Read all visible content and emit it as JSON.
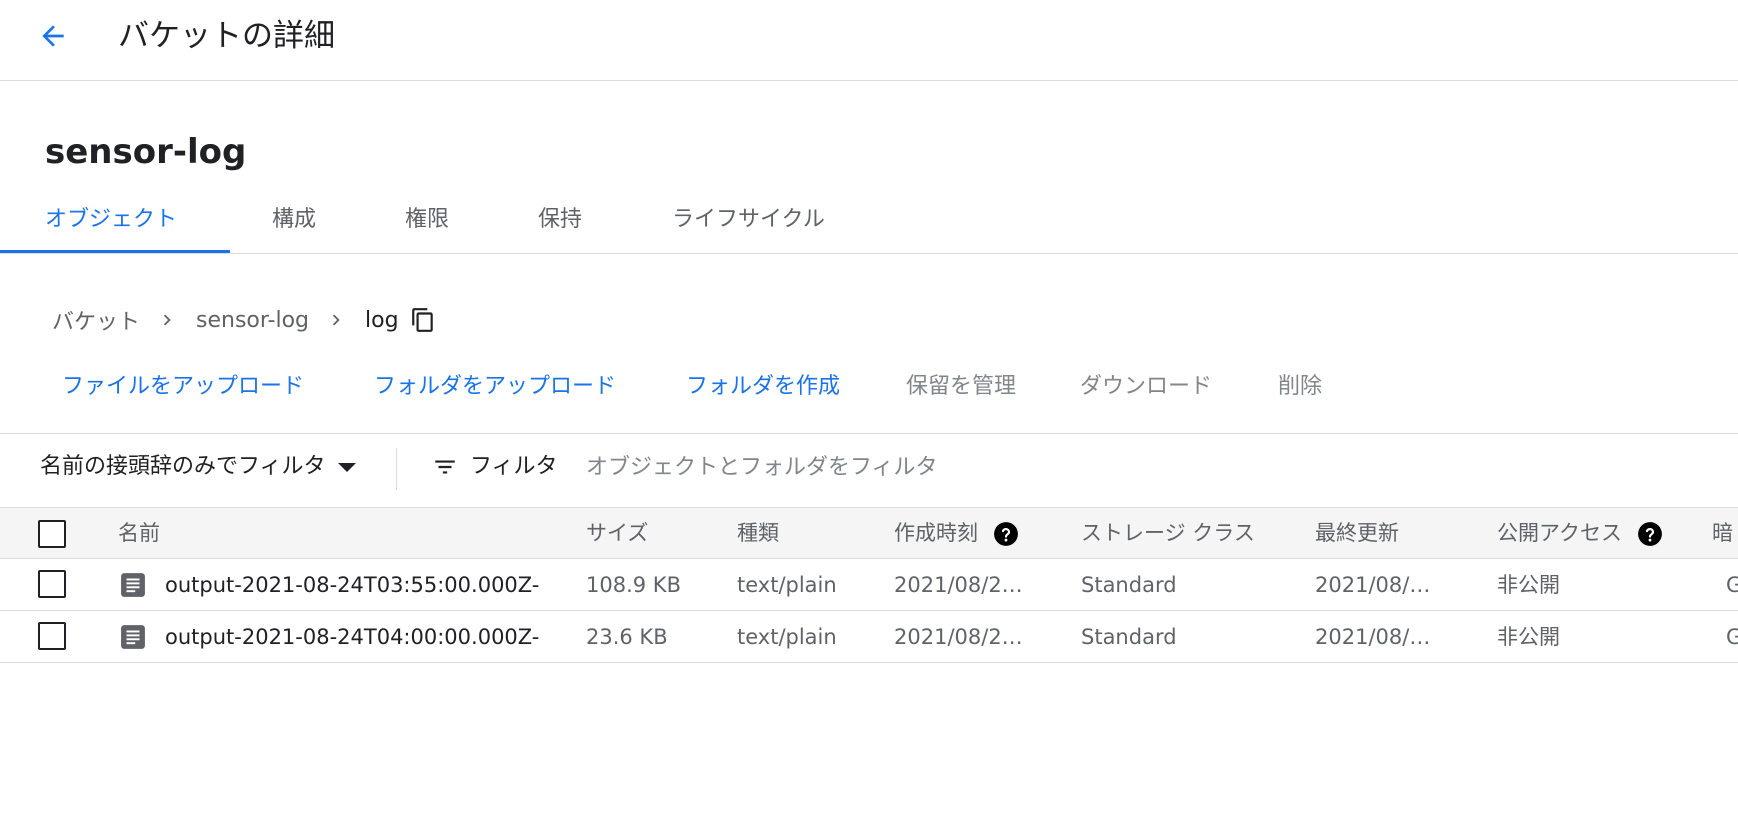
{
  "header": {
    "back_icon": "arrow-left-icon",
    "title": "バケットの詳細"
  },
  "bucket": {
    "name": "sensor-log"
  },
  "tabs": [
    {
      "label": "オブジェクト",
      "active": true
    },
    {
      "label": "構成",
      "active": false
    },
    {
      "label": "権限",
      "active": false
    },
    {
      "label": "保持",
      "active": false
    },
    {
      "label": "ライフサイクル",
      "active": false
    }
  ],
  "breadcrumb": {
    "items": [
      "バケット",
      "sensor-log",
      "log"
    ],
    "copy_icon": "copy-icon"
  },
  "actions": [
    {
      "label": "ファイルをアップロード",
      "enabled": true
    },
    {
      "label": "フォルダをアップロード",
      "enabled": true
    },
    {
      "label": "フォルダを作成",
      "enabled": true
    },
    {
      "label": "保留を管理",
      "enabled": false
    },
    {
      "label": "ダウンロード",
      "enabled": false
    },
    {
      "label": "削除",
      "enabled": false
    }
  ],
  "filter": {
    "prefix_label": "名前の接頭辞のみでフィルタ",
    "filter_label": "フィルタ",
    "placeholder": "オブジェクトとフォルダをフィルタ",
    "value": ""
  },
  "table": {
    "columns": [
      "名前",
      "サイズ",
      "種類",
      "作成時刻",
      "ストレージ クラス",
      "最終更新",
      "公開アクセス",
      "暗"
    ],
    "rows": [
      {
        "name": "output-2021-08-24T03:55:00.000Z-",
        "size": "108.9 KB",
        "type": "text/plain",
        "created": "2021/08/2…",
        "storage_class": "Standard",
        "updated": "2021/08/…",
        "access": "非公開",
        "encryption": "G"
      },
      {
        "name": "output-2021-08-24T04:00:00.000Z-",
        "size": "23.6 KB",
        "type": "text/plain",
        "created": "2021/08/2…",
        "storage_class": "Standard",
        "updated": "2021/08/…",
        "access": "非公開",
        "encryption": "G"
      }
    ]
  },
  "colors": {
    "accent": "#1a73e8",
    "text": "#202124",
    "muted": "#5f6368",
    "divider": "#dadce0",
    "header_bg": "#f5f5f5"
  }
}
